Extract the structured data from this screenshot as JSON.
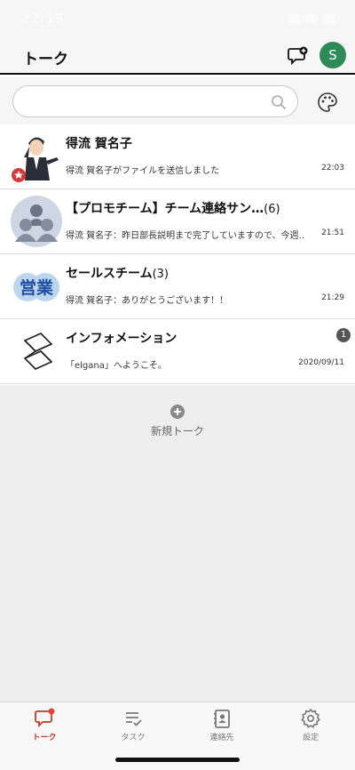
{
  "status_bar": {
    "time": "22:15"
  },
  "header": {
    "title": "トーク",
    "avatar_initial": "S",
    "avatar_color": "#2e8b57"
  },
  "search": {
    "value": "",
    "placeholder": ""
  },
  "talks": [
    {
      "name": "得流 賀名子",
      "count": "",
      "preview": "得流 賀名子がファイルを送信しました",
      "time": "22:03",
      "unread": ""
    },
    {
      "name": "【プロモチーム】チーム連絡サン…",
      "count": "(6)",
      "preview": "得流 賀名子：昨日部長説明まで完了していますので、今週…",
      "time": "21:51",
      "unread": ""
    },
    {
      "name": "セールスチーム",
      "count": "(3)",
      "preview": "得流 賀名子：ありがとうございます！！",
      "time": "21:29",
      "unread": ""
    },
    {
      "name": "インフォメーション",
      "count": "",
      "preview": "「elgana」へようこそ。",
      "time": "2020/09/11",
      "unread": "1"
    }
  ],
  "sales_icon_text": "営業",
  "new_talk": {
    "label": "新規トーク"
  },
  "tabs": [
    {
      "label": "トーク",
      "icon": "chat-icon",
      "active": true
    },
    {
      "label": "タスク",
      "icon": "task-icon",
      "active": false
    },
    {
      "label": "連絡先",
      "icon": "contacts-icon",
      "active": false
    },
    {
      "label": "設定",
      "icon": "gear-icon",
      "active": false
    }
  ],
  "colors": {
    "accent": "#c0392b",
    "header_bg": "#f6f6f6",
    "empty_bg": "#eeeeee"
  }
}
